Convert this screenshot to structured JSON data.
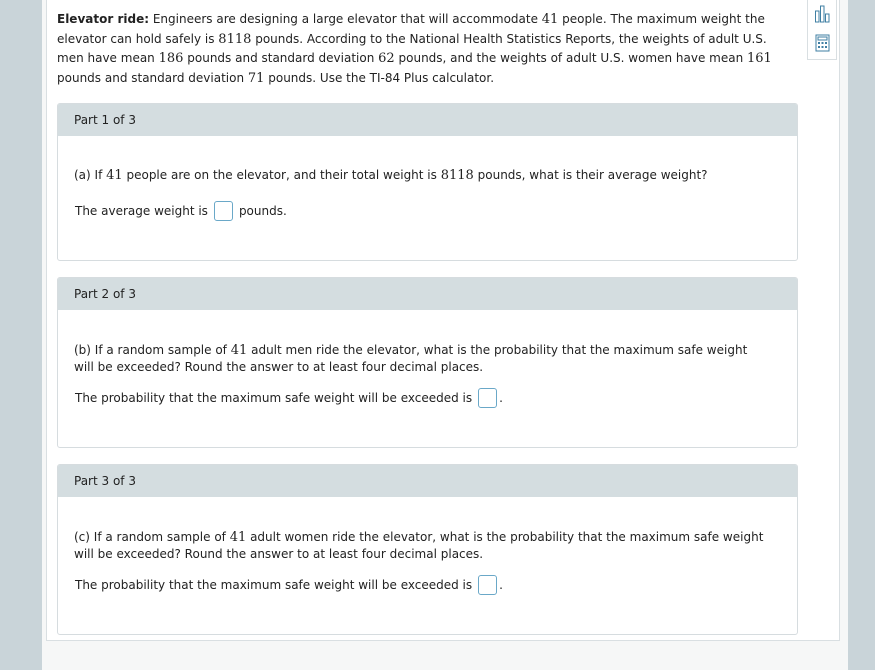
{
  "intro": {
    "title": "Elevator ride:",
    "t1": " Engineers are designing a large elevator that will accommodate ",
    "n_people": "41",
    "t2": " people. The maximum weight the elevator can hold safely is ",
    "max_weight": "8118",
    "t3": " pounds. According to the National Health Statistics Reports, the weights of adult U.S. men have mean ",
    "men_mean": "186",
    "t4": " pounds and standard deviation ",
    "men_sd": "62",
    "t5": " pounds, and the weights of adult U.S. women have mean ",
    "women_mean": "161",
    "t6": " pounds and standard deviation ",
    "women_sd": "71",
    "t7": " pounds. Use the TI-84 Plus calculator."
  },
  "tools": {
    "chart_icon": "bar-chart-icon",
    "calc_icon": "calculator-icon"
  },
  "parts": [
    {
      "header": "Part 1 of 3",
      "q_prefix": "(a) If ",
      "q_n": "41",
      "q_mid": " people are on the elevator, and their total weight is ",
      "q_w": "8118",
      "q_suffix": " pounds, what is their average weight?",
      "answer_prefix": "The average weight is",
      "answer_suffix": "pounds."
    },
    {
      "header": "Part 2 of 3",
      "q_prefix": "(b) If a random sample of ",
      "q_n": "41",
      "q_suffix": " adult men ride the elevator, what is the probability that the maximum safe weight will be exceeded? Round the answer to at least four decimal places.",
      "answer_prefix": "The probability that the maximum safe weight will be exceeded is",
      "answer_suffix": "."
    },
    {
      "header": "Part 3 of 3",
      "q_prefix": "(c) If a random sample of ",
      "q_n": "41",
      "q_suffix": " adult women ride the elevator, what is the probability that the maximum safe weight will be exceeded? Round the answer to at least four decimal places.",
      "answer_prefix": "The probability that the maximum safe weight will be exceeded is",
      "answer_suffix": "."
    }
  ]
}
